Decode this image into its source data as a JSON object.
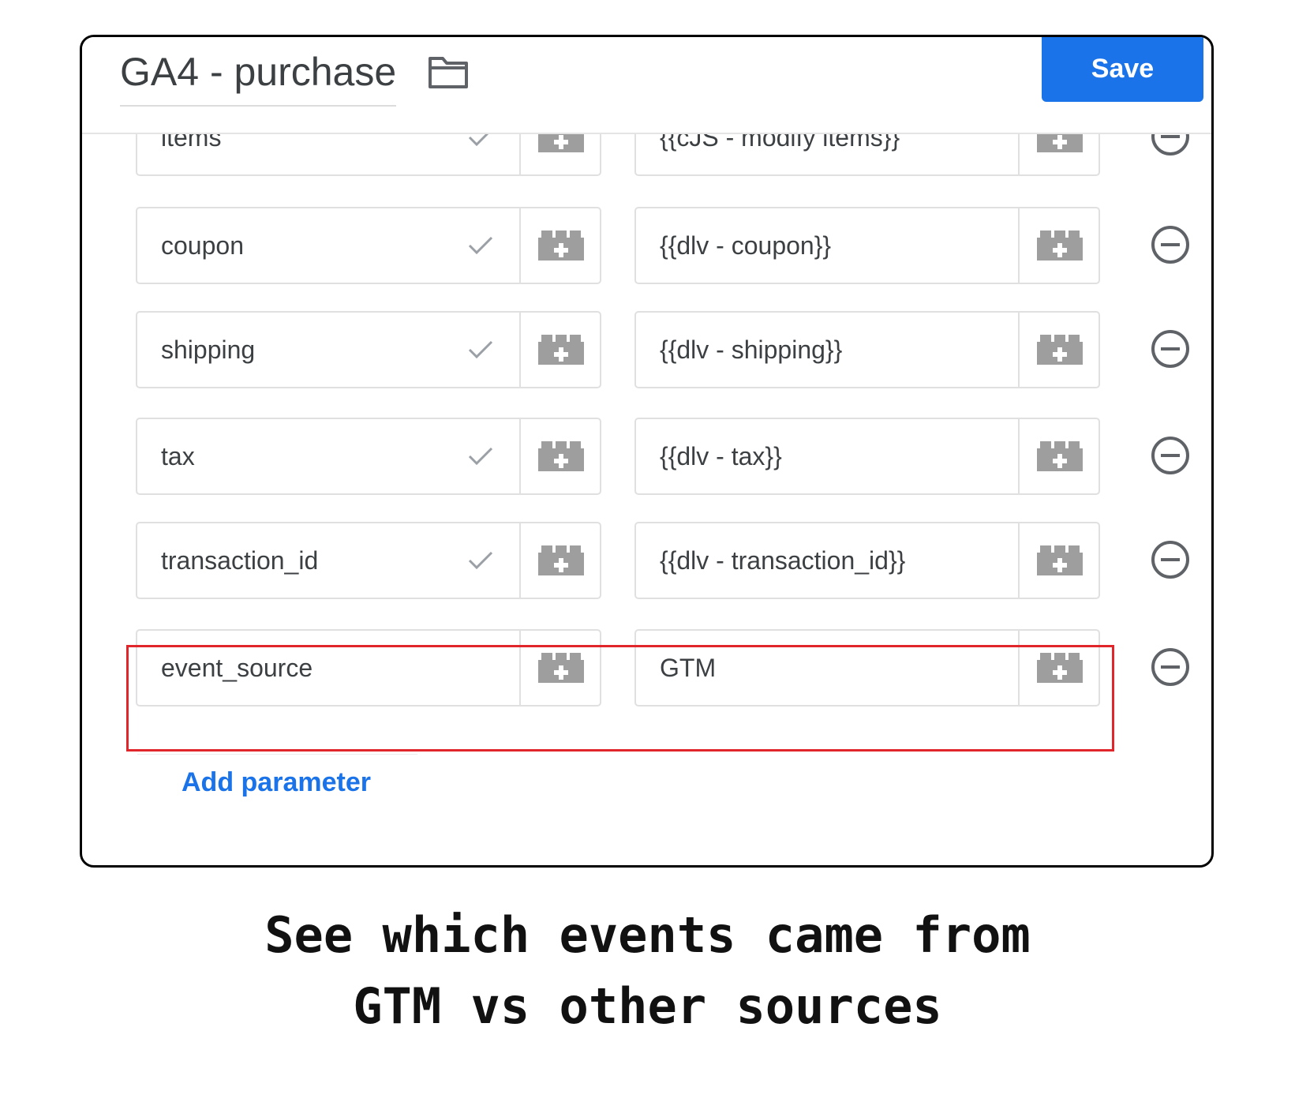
{
  "header": {
    "title": "GA4 - purchase",
    "save_label": "Save"
  },
  "parameters": [
    {
      "name": "items",
      "value": "{{cJS - modify items}}",
      "validated": true
    },
    {
      "name": "coupon",
      "value": "{{dlv - coupon}}",
      "validated": true
    },
    {
      "name": "shipping",
      "value": "{{dlv - shipping}}",
      "validated": true
    },
    {
      "name": "tax",
      "value": "{{dlv - tax}}",
      "validated": true
    },
    {
      "name": "transaction_id",
      "value": "{{dlv - transaction_id}}",
      "validated": true
    },
    {
      "name": "event_source",
      "value": "GTM",
      "validated": false,
      "highlighted": true
    }
  ],
  "add_parameter_label": "Add parameter",
  "caption": {
    "line1": "See which events came from",
    "line2": "GTM vs other sources"
  },
  "colors": {
    "accent": "#1a73e8",
    "highlight": "#e0252b",
    "text": "#3c4043",
    "icon_gray": "#9e9e9e"
  },
  "icons": {
    "folder": "folder-icon",
    "check": "check-icon",
    "variable": "variable-picker-icon",
    "remove": "remove-circle-icon"
  }
}
